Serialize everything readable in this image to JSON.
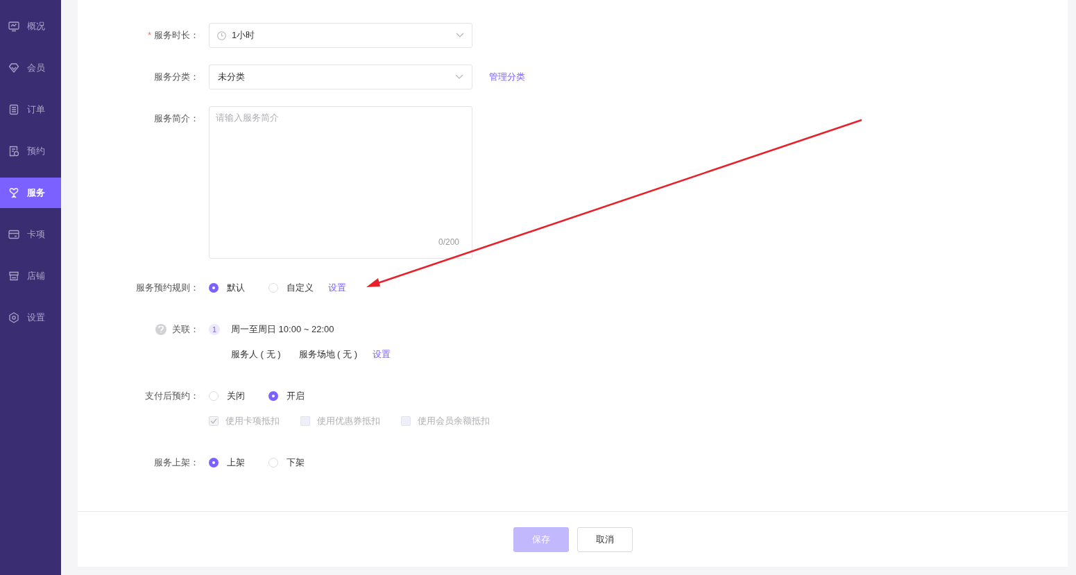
{
  "sidebar": {
    "items": [
      {
        "label": "概况",
        "selected": false
      },
      {
        "label": "会员",
        "selected": false
      },
      {
        "label": "订单",
        "selected": false
      },
      {
        "label": "预约",
        "selected": false
      },
      {
        "label": "服务",
        "selected": true
      },
      {
        "label": "卡项",
        "selected": false
      },
      {
        "label": "店铺",
        "selected": false
      },
      {
        "label": "设置",
        "selected": false
      }
    ]
  },
  "form": {
    "duration": {
      "required_mark": "*",
      "label": "服务时长：",
      "value": "1小时"
    },
    "category": {
      "label": "服务分类：",
      "value": "未分类",
      "link": "管理分类"
    },
    "intro": {
      "label": "服务简介：",
      "placeholder": "请输入服务简介",
      "counter": "0/200"
    },
    "booking_rule": {
      "label": "服务预约规则：",
      "options": [
        {
          "label": "默认",
          "selected": true
        },
        {
          "label": "自定义",
          "selected": false
        }
      ],
      "link": "设置"
    },
    "association": {
      "label": "关联：",
      "badge": "1",
      "schedule": "周一至周日 10:00 ~ 22:00",
      "items": [
        "服务人 ( 无 )",
        "服务场地 ( 无 )"
      ],
      "link": "设置"
    },
    "pay_after": {
      "label": "支付后预约：",
      "options": [
        {
          "label": "关闭",
          "selected": false
        },
        {
          "label": "开启",
          "selected": true
        }
      ],
      "checkboxes": [
        {
          "label": "使用卡项抵扣",
          "checked": true,
          "disabled": true
        },
        {
          "label": "使用优惠券抵扣",
          "checked": false,
          "disabled": true
        },
        {
          "label": "使用会员余额抵扣",
          "checked": false,
          "disabled": true
        }
      ]
    },
    "listing": {
      "label": "服务上架：",
      "options": [
        {
          "label": "上架",
          "selected": true
        },
        {
          "label": "下架",
          "selected": false
        }
      ]
    }
  },
  "buttons": [
    {
      "label": "保存",
      "kind": "primary",
      "disabled": true
    },
    {
      "label": "取消",
      "kind": "default",
      "disabled": false
    }
  ]
}
